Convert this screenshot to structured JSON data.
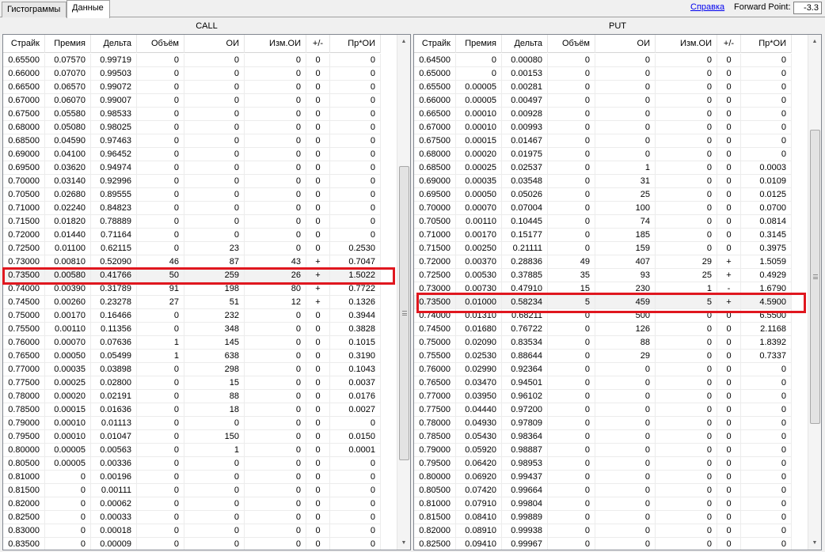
{
  "tabs": [
    {
      "label": "Гистограммы",
      "active": false
    },
    {
      "label": "Данные",
      "active": true
    }
  ],
  "toolbar": {
    "help_link": "Справка",
    "forward_point_label": "Forward Point:",
    "forward_point_value": "-3.3"
  },
  "columns": [
    "Страйк",
    "Премия",
    "Дельта",
    "Объём",
    "ОИ",
    "Изм.ОИ",
    "+/-",
    "Пр*ОИ"
  ],
  "highlight_color": "#e0171f",
  "call": {
    "title": "CALL",
    "highlighted_strike": "0.73500",
    "rows": [
      [
        "0.65500",
        "0.07570",
        "0.99719",
        "0",
        "0",
        "0",
        "0",
        "0"
      ],
      [
        "0.66000",
        "0.07070",
        "0.99503",
        "0",
        "0",
        "0",
        "0",
        "0"
      ],
      [
        "0.66500",
        "0.06570",
        "0.99072",
        "0",
        "0",
        "0",
        "0",
        "0"
      ],
      [
        "0.67000",
        "0.06070",
        "0.99007",
        "0",
        "0",
        "0",
        "0",
        "0"
      ],
      [
        "0.67500",
        "0.05580",
        "0.98533",
        "0",
        "0",
        "0",
        "0",
        "0"
      ],
      [
        "0.68000",
        "0.05080",
        "0.98025",
        "0",
        "0",
        "0",
        "0",
        "0"
      ],
      [
        "0.68500",
        "0.04590",
        "0.97463",
        "0",
        "0",
        "0",
        "0",
        "0"
      ],
      [
        "0.69000",
        "0.04100",
        "0.96452",
        "0",
        "0",
        "0",
        "0",
        "0"
      ],
      [
        "0.69500",
        "0.03620",
        "0.94974",
        "0",
        "0",
        "0",
        "0",
        "0"
      ],
      [
        "0.70000",
        "0.03140",
        "0.92996",
        "0",
        "0",
        "0",
        "0",
        "0"
      ],
      [
        "0.70500",
        "0.02680",
        "0.89555",
        "0",
        "0",
        "0",
        "0",
        "0"
      ],
      [
        "0.71000",
        "0.02240",
        "0.84823",
        "0",
        "0",
        "0",
        "0",
        "0"
      ],
      [
        "0.71500",
        "0.01820",
        "0.78889",
        "0",
        "0",
        "0",
        "0",
        "0"
      ],
      [
        "0.72000",
        "0.01440",
        "0.71164",
        "0",
        "0",
        "0",
        "0",
        "0"
      ],
      [
        "0.72500",
        "0.01100",
        "0.62115",
        "0",
        "23",
        "0",
        "0",
        "0.2530"
      ],
      [
        "0.73000",
        "0.00810",
        "0.52090",
        "46",
        "87",
        "43",
        "+",
        "0.7047"
      ],
      [
        "0.73500",
        "0.00580",
        "0.41766",
        "50",
        "259",
        "26",
        "+",
        "1.5022"
      ],
      [
        "0.74000",
        "0.00390",
        "0.31789",
        "91",
        "198",
        "80",
        "+",
        "0.7722"
      ],
      [
        "0.74500",
        "0.00260",
        "0.23278",
        "27",
        "51",
        "12",
        "+",
        "0.1326"
      ],
      [
        "0.75000",
        "0.00170",
        "0.16466",
        "0",
        "232",
        "0",
        "0",
        "0.3944"
      ],
      [
        "0.75500",
        "0.00110",
        "0.11356",
        "0",
        "348",
        "0",
        "0",
        "0.3828"
      ],
      [
        "0.76000",
        "0.00070",
        "0.07636",
        "1",
        "145",
        "0",
        "0",
        "0.1015"
      ],
      [
        "0.76500",
        "0.00050",
        "0.05499",
        "1",
        "638",
        "0",
        "0",
        "0.3190"
      ],
      [
        "0.77000",
        "0.00035",
        "0.03898",
        "0",
        "298",
        "0",
        "0",
        "0.1043"
      ],
      [
        "0.77500",
        "0.00025",
        "0.02800",
        "0",
        "15",
        "0",
        "0",
        "0.0037"
      ],
      [
        "0.78000",
        "0.00020",
        "0.02191",
        "0",
        "88",
        "0",
        "0",
        "0.0176"
      ],
      [
        "0.78500",
        "0.00015",
        "0.01636",
        "0",
        "18",
        "0",
        "0",
        "0.0027"
      ],
      [
        "0.79000",
        "0.00010",
        "0.01113",
        "0",
        "0",
        "0",
        "0",
        "0"
      ],
      [
        "0.79500",
        "0.00010",
        "0.01047",
        "0",
        "150",
        "0",
        "0",
        "0.0150"
      ],
      [
        "0.80000",
        "0.00005",
        "0.00563",
        "0",
        "1",
        "0",
        "0",
        "0.0001"
      ],
      [
        "0.80500",
        "0.00005",
        "0.00336",
        "0",
        "0",
        "0",
        "0",
        "0"
      ],
      [
        "0.81000",
        "0",
        "0.00196",
        "0",
        "0",
        "0",
        "0",
        "0"
      ],
      [
        "0.81500",
        "0",
        "0.00111",
        "0",
        "0",
        "0",
        "0",
        "0"
      ],
      [
        "0.82000",
        "0",
        "0.00062",
        "0",
        "0",
        "0",
        "0",
        "0"
      ],
      [
        "0.82500",
        "0",
        "0.00033",
        "0",
        "0",
        "0",
        "0",
        "0"
      ],
      [
        "0.83000",
        "0",
        "0.00018",
        "0",
        "0",
        "0",
        "0",
        "0"
      ],
      [
        "0.83500",
        "0",
        "0.00009",
        "0",
        "0",
        "0",
        "0",
        "0"
      ]
    ]
  },
  "put": {
    "title": "PUT",
    "highlighted_strike": "0.73500",
    "rows": [
      [
        "0.64500",
        "0",
        "0.00080",
        "0",
        "0",
        "0",
        "0",
        "0"
      ],
      [
        "0.65000",
        "0",
        "0.00153",
        "0",
        "0",
        "0",
        "0",
        "0"
      ],
      [
        "0.65500",
        "0.00005",
        "0.00281",
        "0",
        "0",
        "0",
        "0",
        "0"
      ],
      [
        "0.66000",
        "0.00005",
        "0.00497",
        "0",
        "0",
        "0",
        "0",
        "0"
      ],
      [
        "0.66500",
        "0.00010",
        "0.00928",
        "0",
        "0",
        "0",
        "0",
        "0"
      ],
      [
        "0.67000",
        "0.00010",
        "0.00993",
        "0",
        "0",
        "0",
        "0",
        "0"
      ],
      [
        "0.67500",
        "0.00015",
        "0.01467",
        "0",
        "0",
        "0",
        "0",
        "0"
      ],
      [
        "0.68000",
        "0.00020",
        "0.01975",
        "0",
        "0",
        "0",
        "0",
        "0"
      ],
      [
        "0.68500",
        "0.00025",
        "0.02537",
        "0",
        "1",
        "0",
        "0",
        "0.0003"
      ],
      [
        "0.69000",
        "0.00035",
        "0.03548",
        "0",
        "31",
        "0",
        "0",
        "0.0109"
      ],
      [
        "0.69500",
        "0.00050",
        "0.05026",
        "0",
        "25",
        "0",
        "0",
        "0.0125"
      ],
      [
        "0.70000",
        "0.00070",
        "0.07004",
        "0",
        "100",
        "0",
        "0",
        "0.0700"
      ],
      [
        "0.70500",
        "0.00110",
        "0.10445",
        "0",
        "74",
        "0",
        "0",
        "0.0814"
      ],
      [
        "0.71000",
        "0.00170",
        "0.15177",
        "0",
        "185",
        "0",
        "0",
        "0.3145"
      ],
      [
        "0.71500",
        "0.00250",
        "0.21111",
        "0",
        "159",
        "0",
        "0",
        "0.3975"
      ],
      [
        "0.72000",
        "0.00370",
        "0.28836",
        "49",
        "407",
        "29",
        "+",
        "1.5059"
      ],
      [
        "0.72500",
        "0.00530",
        "0.37885",
        "35",
        "93",
        "25",
        "+",
        "0.4929"
      ],
      [
        "0.73000",
        "0.00730",
        "0.47910",
        "15",
        "230",
        "1",
        "-",
        "1.6790"
      ],
      [
        "0.73500",
        "0.01000",
        "0.58234",
        "5",
        "459",
        "5",
        "+",
        "4.5900"
      ],
      [
        "0.74000",
        "0.01310",
        "0.68211",
        "0",
        "500",
        "0",
        "0",
        "6.5500"
      ],
      [
        "0.74500",
        "0.01680",
        "0.76722",
        "0",
        "126",
        "0",
        "0",
        "2.1168"
      ],
      [
        "0.75000",
        "0.02090",
        "0.83534",
        "0",
        "88",
        "0",
        "0",
        "1.8392"
      ],
      [
        "0.75500",
        "0.02530",
        "0.88644",
        "0",
        "29",
        "0",
        "0",
        "0.7337"
      ],
      [
        "0.76000",
        "0.02990",
        "0.92364",
        "0",
        "0",
        "0",
        "0",
        "0"
      ],
      [
        "0.76500",
        "0.03470",
        "0.94501",
        "0",
        "0",
        "0",
        "0",
        "0"
      ],
      [
        "0.77000",
        "0.03950",
        "0.96102",
        "0",
        "0",
        "0",
        "0",
        "0"
      ],
      [
        "0.77500",
        "0.04440",
        "0.97200",
        "0",
        "0",
        "0",
        "0",
        "0"
      ],
      [
        "0.78000",
        "0.04930",
        "0.97809",
        "0",
        "0",
        "0",
        "0",
        "0"
      ],
      [
        "0.78500",
        "0.05430",
        "0.98364",
        "0",
        "0",
        "0",
        "0",
        "0"
      ],
      [
        "0.79000",
        "0.05920",
        "0.98887",
        "0",
        "0",
        "0",
        "0",
        "0"
      ],
      [
        "0.79500",
        "0.06420",
        "0.98953",
        "0",
        "0",
        "0",
        "0",
        "0"
      ],
      [
        "0.80000",
        "0.06920",
        "0.99437",
        "0",
        "0",
        "0",
        "0",
        "0"
      ],
      [
        "0.80500",
        "0.07420",
        "0.99664",
        "0",
        "0",
        "0",
        "0",
        "0"
      ],
      [
        "0.81000",
        "0.07910",
        "0.99804",
        "0",
        "0",
        "0",
        "0",
        "0"
      ],
      [
        "0.81500",
        "0.08410",
        "0.99889",
        "0",
        "0",
        "0",
        "0",
        "0"
      ],
      [
        "0.82000",
        "0.08910",
        "0.99938",
        "0",
        "0",
        "0",
        "0",
        "0"
      ],
      [
        "0.82500",
        "0.09410",
        "0.99967",
        "0",
        "0",
        "0",
        "0",
        "0"
      ]
    ]
  }
}
